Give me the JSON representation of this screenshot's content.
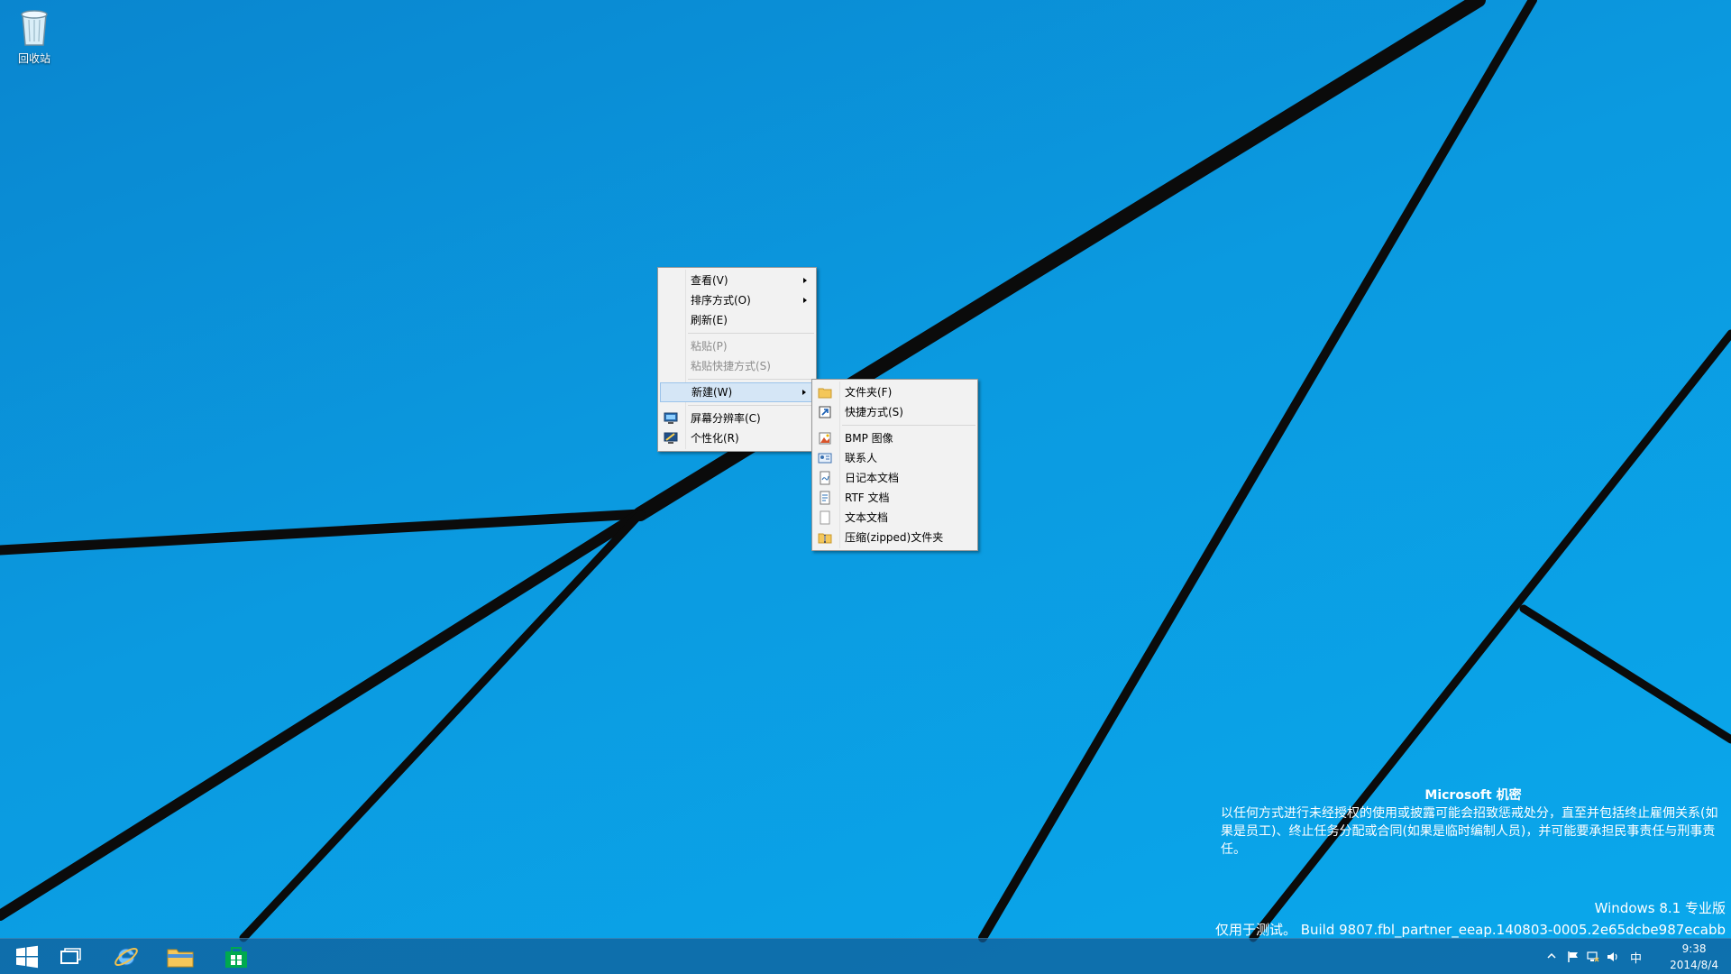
{
  "desktop": {
    "recycle_bin_label": "回收站"
  },
  "context_menu": {
    "view": "查看(V)",
    "sort": "排序方式(O)",
    "refresh": "刷新(E)",
    "paste": "粘贴(P)",
    "paste_shortcut": "粘贴快捷方式(S)",
    "new": "新建(W)",
    "screen_resolution": "屏幕分辨率(C)",
    "personalize": "个性化(R)"
  },
  "new_submenu": {
    "folder": "文件夹(F)",
    "shortcut": "快捷方式(S)",
    "bmp_image": "BMP 图像",
    "contact": "联系人",
    "journal_document": "日记本文档",
    "rtf_document": "RTF 文档",
    "text_document": "文本文档",
    "zipped_folder": "压缩(zipped)文件夹"
  },
  "watermark": {
    "title": "Microsoft 机密",
    "body": "以任何方式进行未经授权的使用或披露可能会招致惩戒处分，直至并包括终止雇佣关系(如果是员工)、终止任务分配或合同(如果是临时编制人员)，并可能要承担民事责任与刑事责任。",
    "edition": "Windows 8.1 专业版",
    "build": "仅用于测试。 Build 9807.fbl_partner_eeap.140803-0005.2e65dcbe987ecabb"
  },
  "taskbar": {
    "start_icon": "windows-logo-icon",
    "pinned": [
      "task-view-icon",
      "internet-explorer-icon",
      "file-explorer-icon",
      "store-icon"
    ],
    "ime_indicator": "中",
    "clock_time": "9:38",
    "clock_date": "2014/8/4"
  },
  "colors": {
    "desktop_blue": "#0a9be0",
    "menu_background": "#f2f2f2",
    "menu_highlight": "#d5e6f6"
  }
}
